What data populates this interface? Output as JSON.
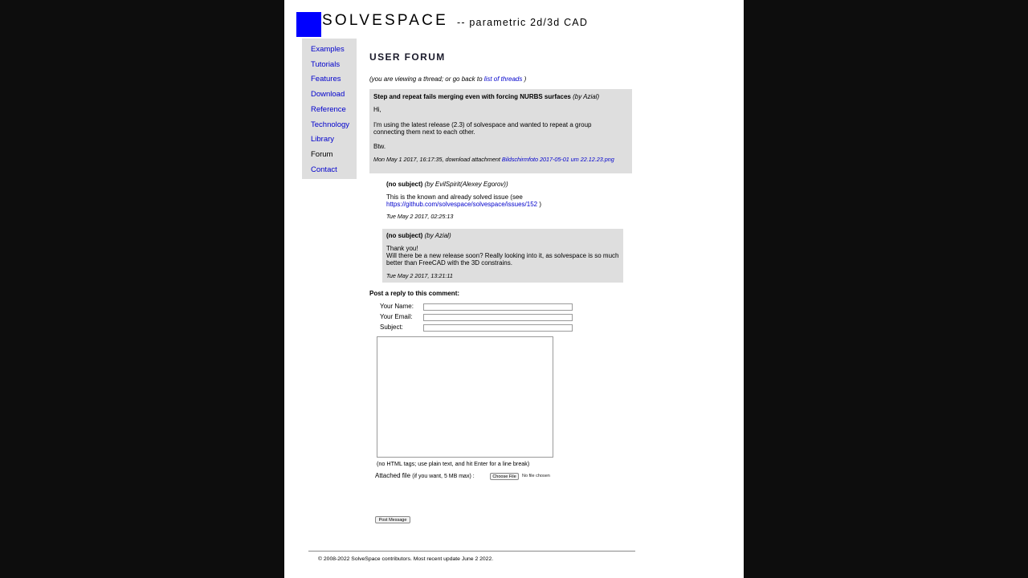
{
  "header": {
    "brand": "SOLVESPACE",
    "tagline": "-- parametric 2d/3d CAD",
    "logo_color": "#0000ff"
  },
  "sidebar": {
    "items": [
      {
        "label": "Examples",
        "current": false
      },
      {
        "label": "Tutorials",
        "current": false
      },
      {
        "label": "Features",
        "current": false
      },
      {
        "label": "Download",
        "current": false
      },
      {
        "label": "Reference",
        "current": false
      },
      {
        "label": "Technology",
        "current": false
      },
      {
        "label": "Library",
        "current": false
      },
      {
        "label": "Forum",
        "current": true
      },
      {
        "label": "Contact",
        "current": false
      }
    ]
  },
  "main": {
    "title": "USER FORUM",
    "thread_nav": {
      "prefix": "(you are viewing a thread; or go back to",
      "link": "list of threads",
      "suffix": ")"
    }
  },
  "posts": [
    {
      "subject": "Step and repeat fails merging even with forcing NURBS surfaces",
      "author": "(by Azial)",
      "body": [
        "Hi,",
        "I'm using the latest release (2.3) of solvespace and wanted to repeat a group connecting them next to each other.",
        "Btw."
      ],
      "meta_prefix": "Mon May 1 2017, 16:17:35, download attachment",
      "attachment": "Bildschirmfoto 2017-05-01 um 22.12.23.png"
    },
    {
      "subject": "(no subject)",
      "author": "(by EvilSpirit(Alexey Egorov))",
      "body_prefix": "This is the known and already solved issue (see",
      "link": "https://github.com/solvespace/solvespace/issues/152",
      "body_suffix": ")",
      "meta": "Tue May 2 2017, 02:25:13"
    },
    {
      "subject": "(no subject)",
      "author": "(by Azial)",
      "body": [
        "Thank you!",
        "Will there be a new release soon? Really looking into it, as solvespace is so much better than FreeCAD with the 3D constrains."
      ],
      "meta": "Tue May 2 2017, 13:21:11"
    }
  ],
  "reply_form": {
    "heading": "Post a reply to this comment:",
    "name_label": "Your Name:",
    "email_label": "Your Email:",
    "subject_label": "Subject:",
    "hint": "(no HTML tags; use plain text, and hit Enter for a line break)",
    "attach_label": "Attached file",
    "attach_note": "(if you want, 5 MB max) :",
    "choose_file": "Choose File",
    "no_file": "No file chosen",
    "submit": "Post Message"
  },
  "footer": {
    "text": "© 2008-2022 SolveSpace contributors. Most recent update June 2 2022."
  }
}
